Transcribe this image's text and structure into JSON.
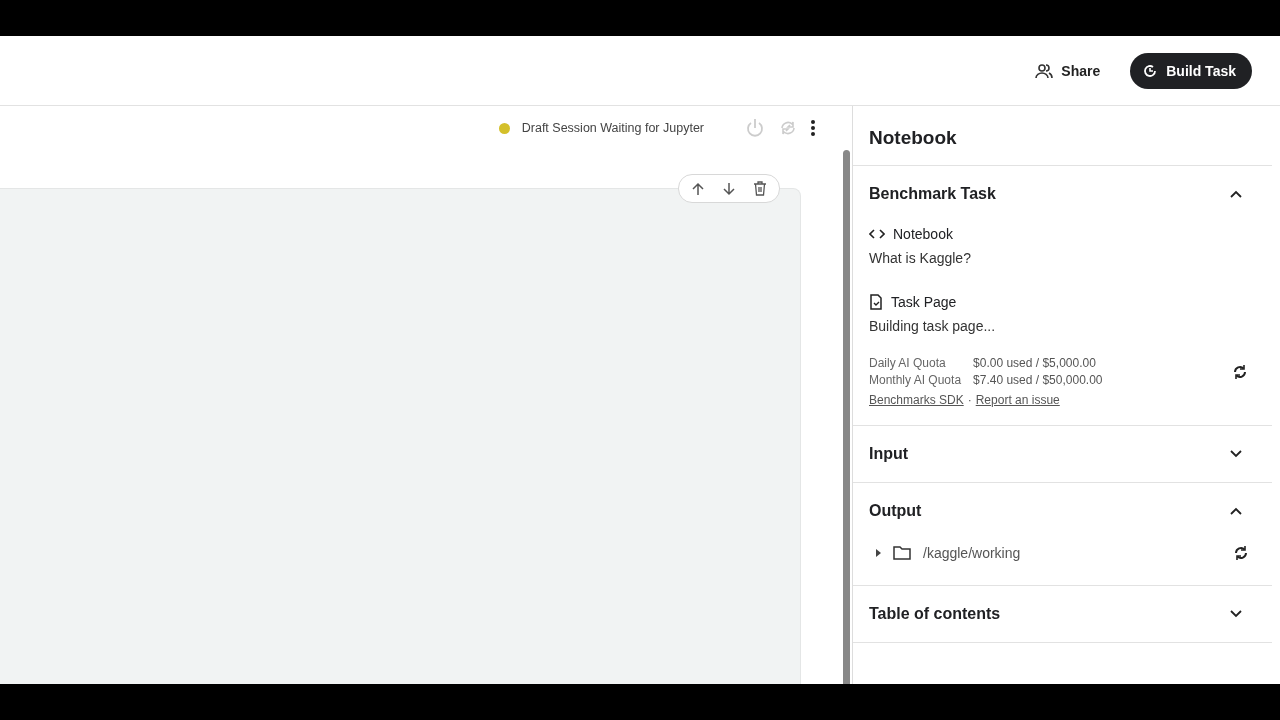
{
  "header": {
    "share": "Share",
    "build": "Build Task"
  },
  "session": {
    "status": "Draft Session Waiting for Jupyter"
  },
  "panel": {
    "title": "Notebook",
    "sections": [
      {
        "kind": "benchmark",
        "title": "Benchmark Task",
        "expanded": true,
        "notebook_label": "Notebook",
        "notebook_name": "What is Kaggle?",
        "task_label": "Task Page",
        "task_status": "Building task page...",
        "quotas": [
          {
            "label": "Daily AI Quota",
            "value": "$0.00 used / $5,000.00"
          },
          {
            "label": "Monthly AI Quota",
            "value": "$7.40 used / $50,000.00"
          }
        ],
        "links": [
          "Benchmarks SDK",
          "Report an issue"
        ],
        "separator": "·"
      },
      {
        "title": "Input",
        "expanded": false
      },
      {
        "kind": "output",
        "title": "Output",
        "expanded": true,
        "folder": "/kaggle/working"
      },
      {
        "title": "Table of contents",
        "expanded": false
      }
    ]
  }
}
